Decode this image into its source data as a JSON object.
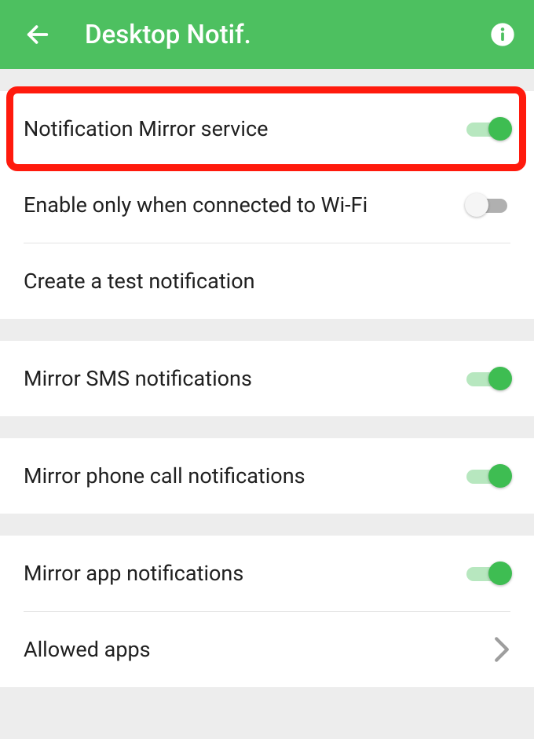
{
  "appbar": {
    "title": "Desktop Notif."
  },
  "rows": {
    "mirror_service": {
      "label": "Notification Mirror service",
      "on": true
    },
    "wifi_only": {
      "label": "Enable only when connected to Wi-Fi",
      "on": false
    },
    "test_notif": {
      "label": "Create a test notification"
    },
    "mirror_sms": {
      "label": "Mirror SMS notifications",
      "on": true
    },
    "mirror_call": {
      "label": "Mirror phone call notifications",
      "on": true
    },
    "mirror_app": {
      "label": "Mirror app notifications",
      "on": true
    },
    "allowed_apps": {
      "label": "Allowed apps"
    }
  },
  "highlight": {
    "target": "mirror_service"
  }
}
